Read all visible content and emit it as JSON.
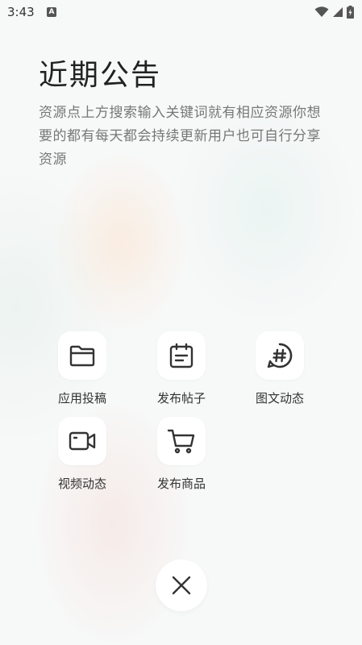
{
  "status_bar": {
    "time": "3:43",
    "notification_letter": "A"
  },
  "notice": {
    "title": "近期公告",
    "description": "资源点上方搜索输入关键词就有相应资源你想要的都有每天都会持续更新用户也可自行分享资源"
  },
  "actions": [
    {
      "label": "应用投稿",
      "icon": "folder-icon"
    },
    {
      "label": "发布帖子",
      "icon": "calendar-icon"
    },
    {
      "label": "图文动态",
      "icon": "hashtag-bubble-icon"
    },
    {
      "label": "视频动态",
      "icon": "video-camera-icon"
    },
    {
      "label": "发布商品",
      "icon": "shopping-cart-icon"
    }
  ],
  "colors": {
    "text_primary": "#222222",
    "text_secondary": "#777777",
    "icon_stroke": "#333333"
  }
}
